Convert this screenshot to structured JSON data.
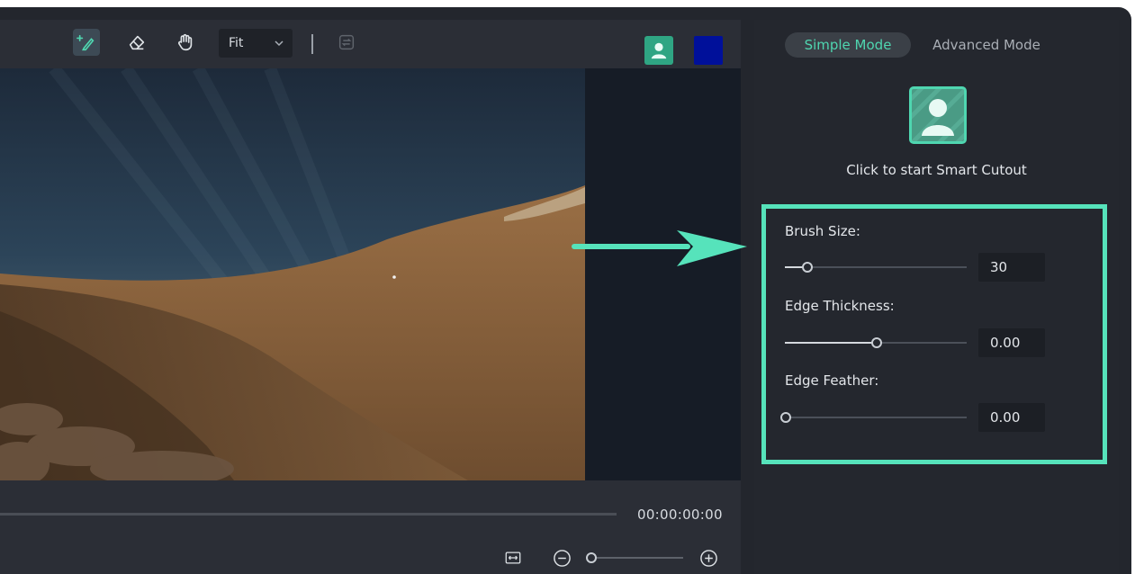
{
  "toolbar": {
    "tools": [
      {
        "name": "smart-brush",
        "icon": "brush-plus-icon"
      },
      {
        "name": "eraser",
        "icon": "eraser-icon"
      },
      {
        "name": "hand",
        "icon": "hand-icon"
      }
    ],
    "fit_value": "Fit",
    "colors": {
      "accent": "#4fd6b0",
      "swatch": "#00109a",
      "user_button": "#2fa583"
    }
  },
  "timeline": {
    "timecode": "00:00:00:00"
  },
  "panel": {
    "modes": {
      "simple": "Simple Mode",
      "advanced": "Advanced Mode",
      "selected": "Simple Mode"
    },
    "cutout_prompt": "Click to start Smart Cutout",
    "settings": {
      "brush_size": {
        "label": "Brush Size:",
        "value": "30",
        "level": 0.12
      },
      "edge_thickness": {
        "label": "Edge Thickness:",
        "value": "0.00",
        "level": 0.5
      },
      "edge_feather": {
        "label": "Edge Feather:",
        "value": "0.00",
        "level": 0.0
      }
    }
  }
}
